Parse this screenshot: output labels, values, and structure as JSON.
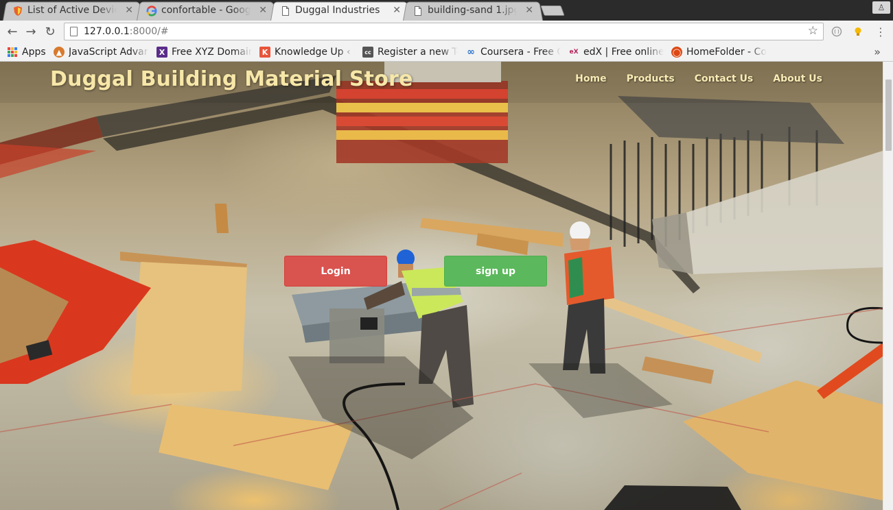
{
  "browser": {
    "tabs": [
      {
        "title": "List of Active Devic",
        "favicon": "shield-icon",
        "active": false
      },
      {
        "title": "confortable - Googl",
        "favicon": "google-icon",
        "active": false
      },
      {
        "title": "Duggal Industries",
        "favicon": "page-icon",
        "active": true
      },
      {
        "title": "building-sand 1.jpg",
        "favicon": "page-icon",
        "active": false
      }
    ],
    "close_glyph": "✕",
    "url_host": "127.0.0.1",
    "url_rest": ":8000/#",
    "bookmarks": [
      {
        "label": "Apps",
        "icon": "apps-grid-icon"
      },
      {
        "label": "JavaScript Advar",
        "icon": "fox-icon"
      },
      {
        "label": "Free XYZ Domain",
        "icon": "xyz-icon"
      },
      {
        "label": "Knowledge Up ‹ L",
        "icon": "knowledge-icon"
      },
      {
        "label": "Register a new Te",
        "icon": "cc-icon"
      },
      {
        "label": "Coursera - Free O",
        "icon": "coursera-icon"
      },
      {
        "label": "edX | Free online",
        "icon": "edx-icon"
      },
      {
        "label": "HomeFolder - Co",
        "icon": "ubuntu-icon"
      }
    ],
    "bookmarks_overflow": "»"
  },
  "site": {
    "brand": "Duggal Building Material Store",
    "nav": [
      "Home",
      "Products",
      "Contact Us",
      "About Us"
    ],
    "login_label": "Login",
    "signup_label": "sign up",
    "colors": {
      "brand_text": "#f7e7a8",
      "login_bg": "#d9534f",
      "signup_bg": "#5cb85c"
    }
  }
}
